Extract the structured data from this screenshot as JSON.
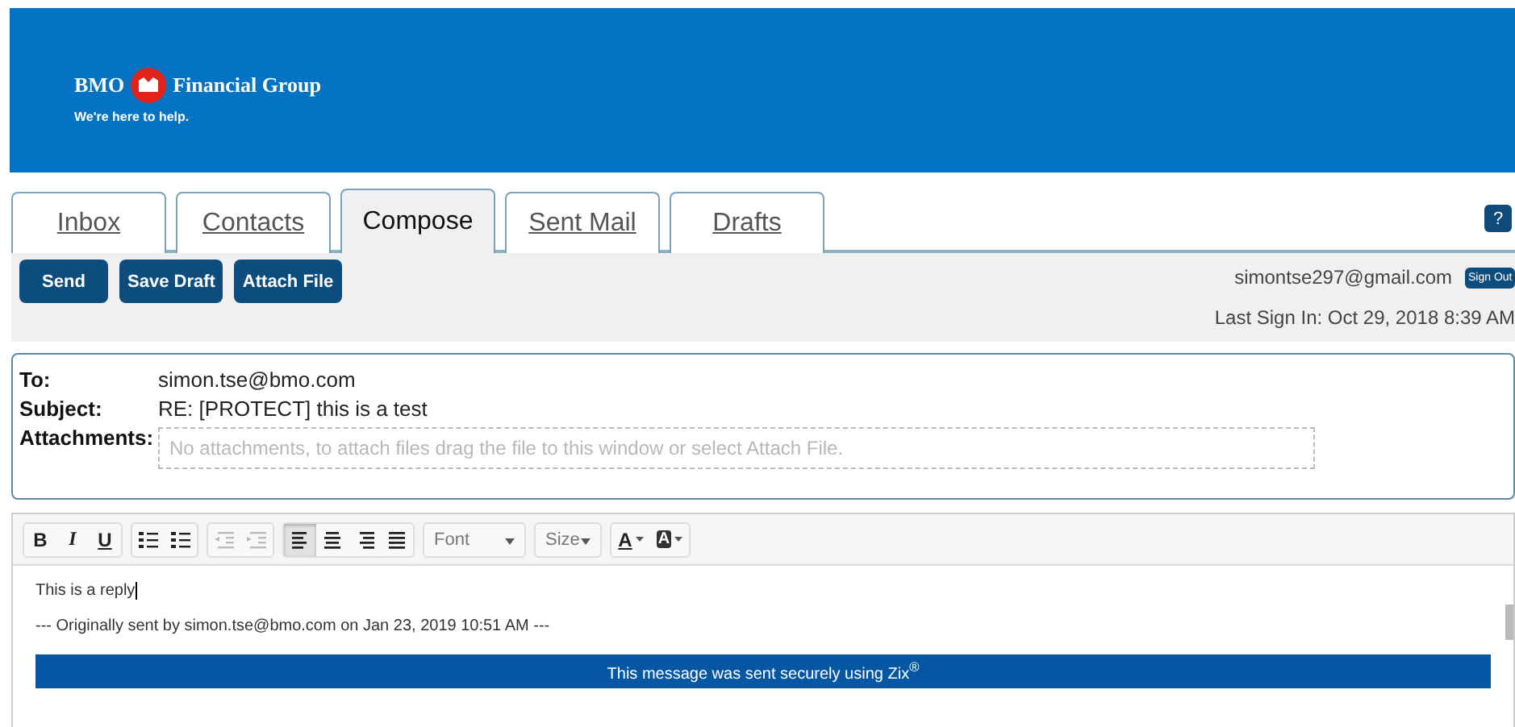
{
  "banner": {
    "brand": "BMO",
    "company": "Financial Group",
    "tagline": "We're here to help."
  },
  "tabs": [
    {
      "label": "Inbox",
      "selected": false
    },
    {
      "label": "Contacts",
      "selected": false
    },
    {
      "label": "Compose",
      "selected": true
    },
    {
      "label": "Sent Mail",
      "selected": false
    },
    {
      "label": "Drafts",
      "selected": false
    }
  ],
  "help_button": "?",
  "actions": [
    "Send",
    "Save Draft",
    "Attach File"
  ],
  "account": {
    "email": "simontse297@gmail.com",
    "sign_out": "Sign Out",
    "last_sign_in": "Last Sign In: Oct 29, 2018 8:39 AM"
  },
  "fields": [
    {
      "label": "To:",
      "value": "simon.tse@bmo.com"
    },
    {
      "label": "Subject:",
      "value": "RE: [PROTECT] this is a test"
    }
  ],
  "attachments": {
    "label": "Attachments:",
    "placeholder": "No attachments, to attach files drag the file to this window or select Attach File."
  },
  "editor_toolbar": [
    [
      {
        "kind": "bold",
        "text": "B",
        "disabled": false,
        "selected": false
      },
      {
        "kind": "italic",
        "text": "I",
        "disabled": false,
        "selected": false
      },
      {
        "kind": "underline",
        "text": "U",
        "disabled": false,
        "selected": false
      }
    ],
    [
      {
        "kind": "numbered-list",
        "disabled": false,
        "selected": false
      },
      {
        "kind": "bulleted-list",
        "disabled": false,
        "selected": false
      }
    ],
    [
      {
        "kind": "outdent",
        "disabled": true,
        "selected": false
      },
      {
        "kind": "indent",
        "disabled": true,
        "selected": false
      }
    ],
    [
      {
        "kind": "align-left",
        "disabled": false,
        "selected": true
      },
      {
        "kind": "align-center",
        "disabled": false,
        "selected": false
      },
      {
        "kind": "align-right",
        "disabled": false,
        "selected": false
      },
      {
        "kind": "justify",
        "disabled": false,
        "selected": false
      }
    ]
  ],
  "dropdowns": [
    {
      "label": "Font"
    },
    {
      "label": "Size"
    }
  ],
  "colors": [
    {
      "kind": "text-color",
      "text": "A"
    },
    {
      "kind": "background-color",
      "text": "A"
    }
  ],
  "body": {
    "lines": [
      "This is a reply",
      "--- Originally sent by simon.tse@bmo.com on Jan 23, 2019 10:51 AM ---"
    ],
    "banner": "This message was sent securely using Zix$^{®}$"
  }
}
